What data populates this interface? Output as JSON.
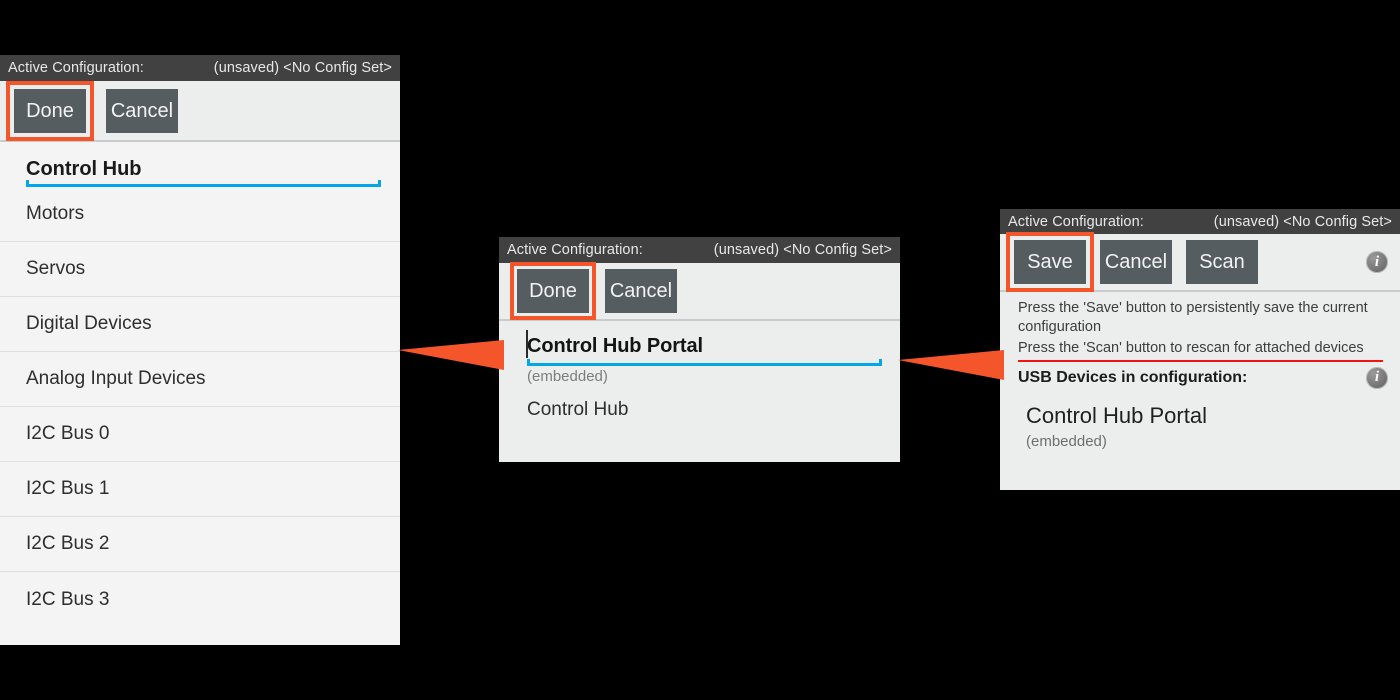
{
  "meta": {
    "accent_orange": "#f4552b",
    "accent_blue": "#03a6e8",
    "accent_red": "#f01414",
    "titlebar_bg": "#414141",
    "panel_bg": "#eceded",
    "button_bg": "#555d61"
  },
  "left_panel": {
    "titlebar": {
      "label": "Active Configuration:",
      "value": "(unsaved) <No Config Set>"
    },
    "buttons": {
      "done": "Done",
      "cancel": "Cancel"
    },
    "selected_header": "Control Hub",
    "items": [
      {
        "label": "Motors"
      },
      {
        "label": "Servos"
      },
      {
        "label": "Digital Devices"
      },
      {
        "label": "Analog Input Devices"
      },
      {
        "label": "I2C Bus 0"
      },
      {
        "label": "I2C Bus 1"
      },
      {
        "label": "I2C Bus 2"
      },
      {
        "label": "I2C Bus 3"
      }
    ]
  },
  "middle_panel": {
    "titlebar": {
      "label": "Active Configuration:",
      "value": "(unsaved) <No Config Set>"
    },
    "buttons": {
      "done": "Done",
      "cancel": "Cancel"
    },
    "device_name": "Control Hub Portal",
    "device_sub": "(embedded)",
    "child_item": "Control Hub"
  },
  "right_panel": {
    "titlebar": {
      "label": "Active Configuration:",
      "value": "(unsaved) <No Config Set>"
    },
    "buttons": {
      "save": "Save",
      "cancel": "Cancel",
      "scan": "Scan"
    },
    "info_icon_glyph": "i",
    "hints": [
      "Press the 'Save' button to persistently save the current configuration",
      "Press the 'Scan' button to rescan for attached devices"
    ],
    "usb_section_label": "USB Devices in configuration:",
    "device_name": "Control Hub Portal",
    "device_sub": "(embedded)"
  }
}
